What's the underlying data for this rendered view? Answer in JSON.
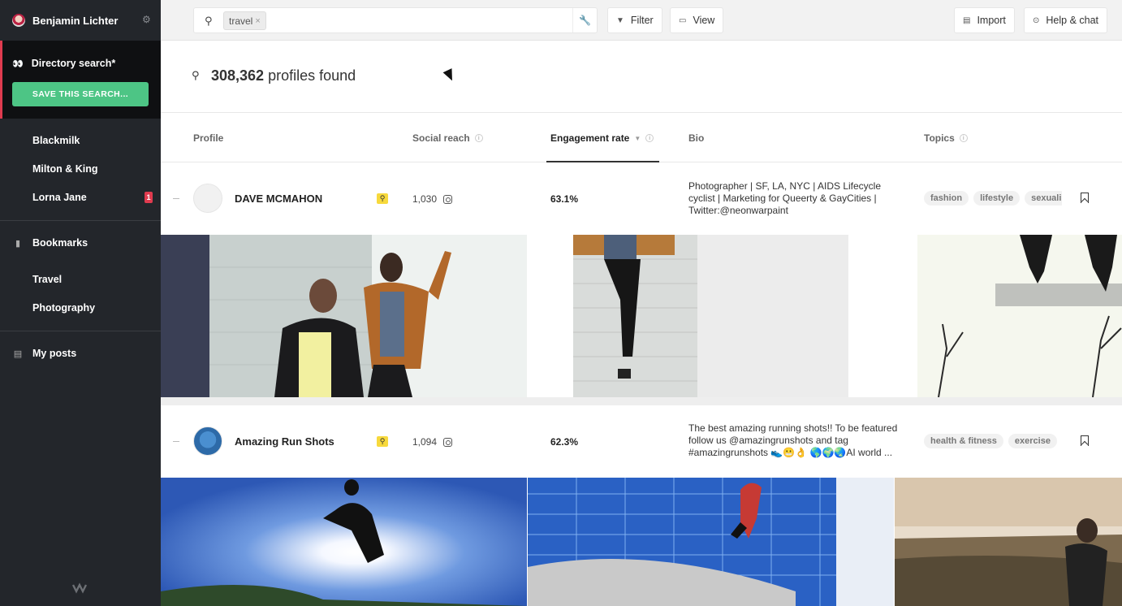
{
  "user": {
    "name": "Benjamin Lichter"
  },
  "sidebar": {
    "active_search": "Directory search*",
    "save_button": "SAVE THIS SEARCH...",
    "brands": [
      {
        "label": "Blackmilk"
      },
      {
        "label": "Milton & King"
      },
      {
        "label": "Lorna Jane",
        "badge": "1"
      }
    ],
    "bookmarks_label": "Bookmarks",
    "bookmark_lists": [
      {
        "label": "Travel"
      },
      {
        "label": "Photography"
      }
    ],
    "my_posts_label": "My posts"
  },
  "topbar": {
    "search_chip": "travel",
    "filter_label": "Filter",
    "view_label": "View",
    "import_label": "Import",
    "help_label": "Help & chat"
  },
  "results": {
    "count": "308,362",
    "suffix": "profiles found"
  },
  "columns": {
    "profile": "Profile",
    "social_reach": "Social reach",
    "engagement": "Engagement rate",
    "bio": "Bio",
    "topics": "Topics"
  },
  "rows": [
    {
      "name": "DAVE MCMAHON",
      "reach": "1,030",
      "engagement": "63.1%",
      "bio": "Photographer | SF, LA, NYC | AIDS Lifecycle cyclist | Marketing for Queerty & GayCities | Twitter:@neonwarpaint",
      "topics": [
        "fashion",
        "lifestyle",
        "sexuali"
      ]
    },
    {
      "name": "Amazing Run Shots",
      "reach": "1,094",
      "engagement": "62.3%",
      "bio": "The best amazing running shots!! To be featured follow us @amazingrunshots and tag #amazingrunshots 👟😬👌 🌎🌍🌏AI world ...",
      "topics": [
        "health & fitness",
        "exercise"
      ]
    }
  ],
  "colors": {
    "sidebar_bg": "#23262b",
    "active_bg": "#0f1012",
    "accent_red": "#e03b4f",
    "save_green": "#4dc585",
    "search_tag_yellow": "#f7d93c"
  }
}
